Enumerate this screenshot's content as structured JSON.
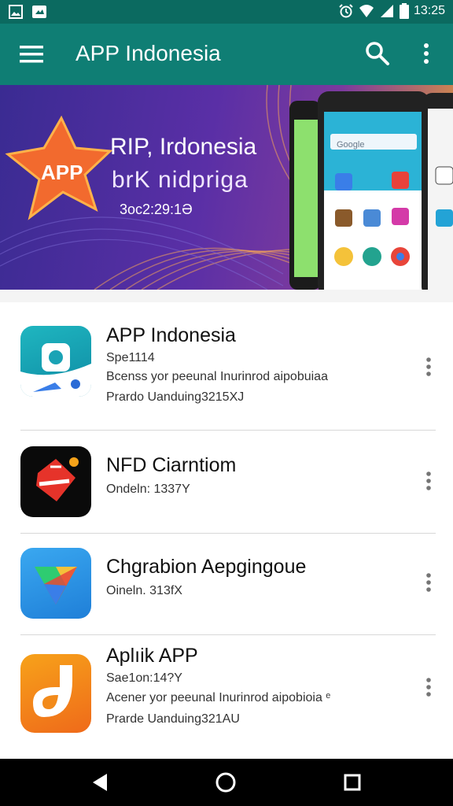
{
  "status_bar": {
    "time": "13:25",
    "icons": [
      "image-icon",
      "video-icon",
      "alarm-icon",
      "wifi-icon",
      "signal-icon",
      "battery-icon"
    ]
  },
  "app_bar": {
    "title": "APP Indonesia",
    "icons": [
      "menu-icon",
      "search-icon",
      "more-vert-icon"
    ],
    "color": "#0f7e74"
  },
  "banner": {
    "star_label": "APP",
    "title": "RIP, Irdonesia",
    "subtitle": "brK nidpriga",
    "code": "3oc2:29:1Ə",
    "phone_search": "Google"
  },
  "apps": [
    {
      "name": "APP Indonesia",
      "lines": [
        "Spe1114",
        "Bcenss yor peeunal Inurinrod aipobuiaa",
        "Prardo  Uanduing3215XJ"
      ]
    },
    {
      "name": "NFD Ciarntiom",
      "lines": [
        "Ondeln: 1337Y"
      ]
    },
    {
      "name": "Chgrabion Aepgingoue",
      "lines": [
        "Oineln. 313fX"
      ]
    },
    {
      "name": "Aplıik APP",
      "lines": [
        "Sae1on:14?Y",
        "Acener yor peeunal Inurinrod aipobioia  ᵉ",
        "Prarde  Uanduing321AU"
      ]
    }
  ],
  "nav_bar": {
    "icons": [
      "back-icon",
      "home-icon",
      "recents-icon"
    ]
  }
}
